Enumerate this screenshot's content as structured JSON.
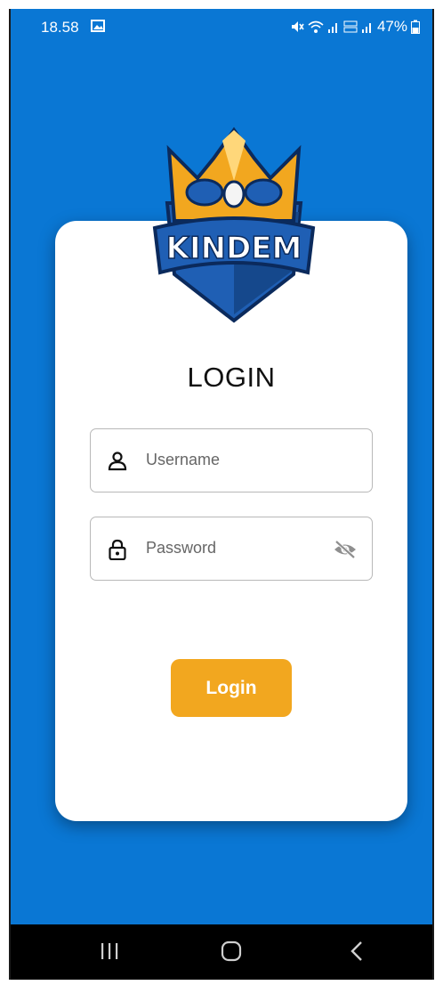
{
  "status_bar": {
    "time": "18.58",
    "battery_percent": "47%",
    "icons": [
      "image-icon",
      "mute-icon",
      "wifi-icon",
      "signal-icon",
      "volte-icon",
      "signal-icon",
      "battery-icon"
    ]
  },
  "logo": {
    "text": "KINDEM",
    "colors": {
      "crown": "#f2a71f",
      "shield": "#1f5fb4",
      "outline": "#0b2a5c"
    }
  },
  "login_form": {
    "title": "LOGIN",
    "username": {
      "placeholder": "Username",
      "icon": "person-icon"
    },
    "password": {
      "placeholder": "Password",
      "icon": "lock-icon",
      "toggle_icon": "eye-off-icon"
    },
    "submit_label": "Login"
  },
  "nav_bar": {
    "buttons": [
      "recents-icon",
      "home-icon",
      "back-icon"
    ]
  },
  "colors": {
    "background": "#0a77d4",
    "card": "#ffffff",
    "button": "#f2a71f",
    "button_text": "#ffffff"
  }
}
